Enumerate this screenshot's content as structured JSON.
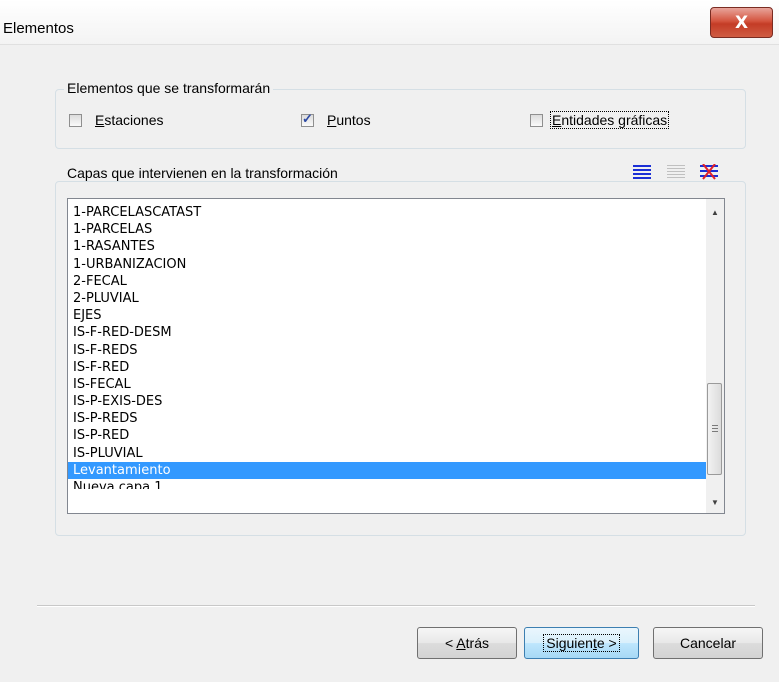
{
  "window": {
    "title": "Elementos",
    "close_glyph": "X"
  },
  "elements_group": {
    "label": "Elementos que se transformarán",
    "checkboxes": [
      {
        "label": "Estaciones",
        "checked": false
      },
      {
        "label": "Puntos",
        "checked": true
      },
      {
        "label": "Entidades gráficas",
        "checked": false,
        "focused": true
      }
    ]
  },
  "layers_group": {
    "label": "Capas que intervienen en la transformación",
    "toolbar_icons": [
      "select-all-icon",
      "deselect-all-icon",
      "invert-selection-icon"
    ],
    "items": [
      "1-PARCELASCATAST",
      "1-PARCELAS",
      "1-RASANTES",
      "1-URBANIZACION",
      "2-FECAL",
      "2-PLUVIAL",
      "EJES",
      "IS-F-RED-DESM",
      "IS-F-REDS",
      "IS-F-RED",
      "IS-FECAL",
      "IS-P-EXIS-DES",
      "IS-P-REDS",
      "IS-P-RED",
      "IS-PLUVIAL",
      "Levantamiento",
      "Nueva capa 1"
    ],
    "selected_item": "Levantamiento"
  },
  "buttons": {
    "back": "< Atrás",
    "next": "Siguiente >",
    "cancel": "Cancelar"
  },
  "colors": {
    "accent_selection": "#3399ff",
    "icon_blue": "#1b2fd6",
    "icon_red": "#e0202a"
  }
}
